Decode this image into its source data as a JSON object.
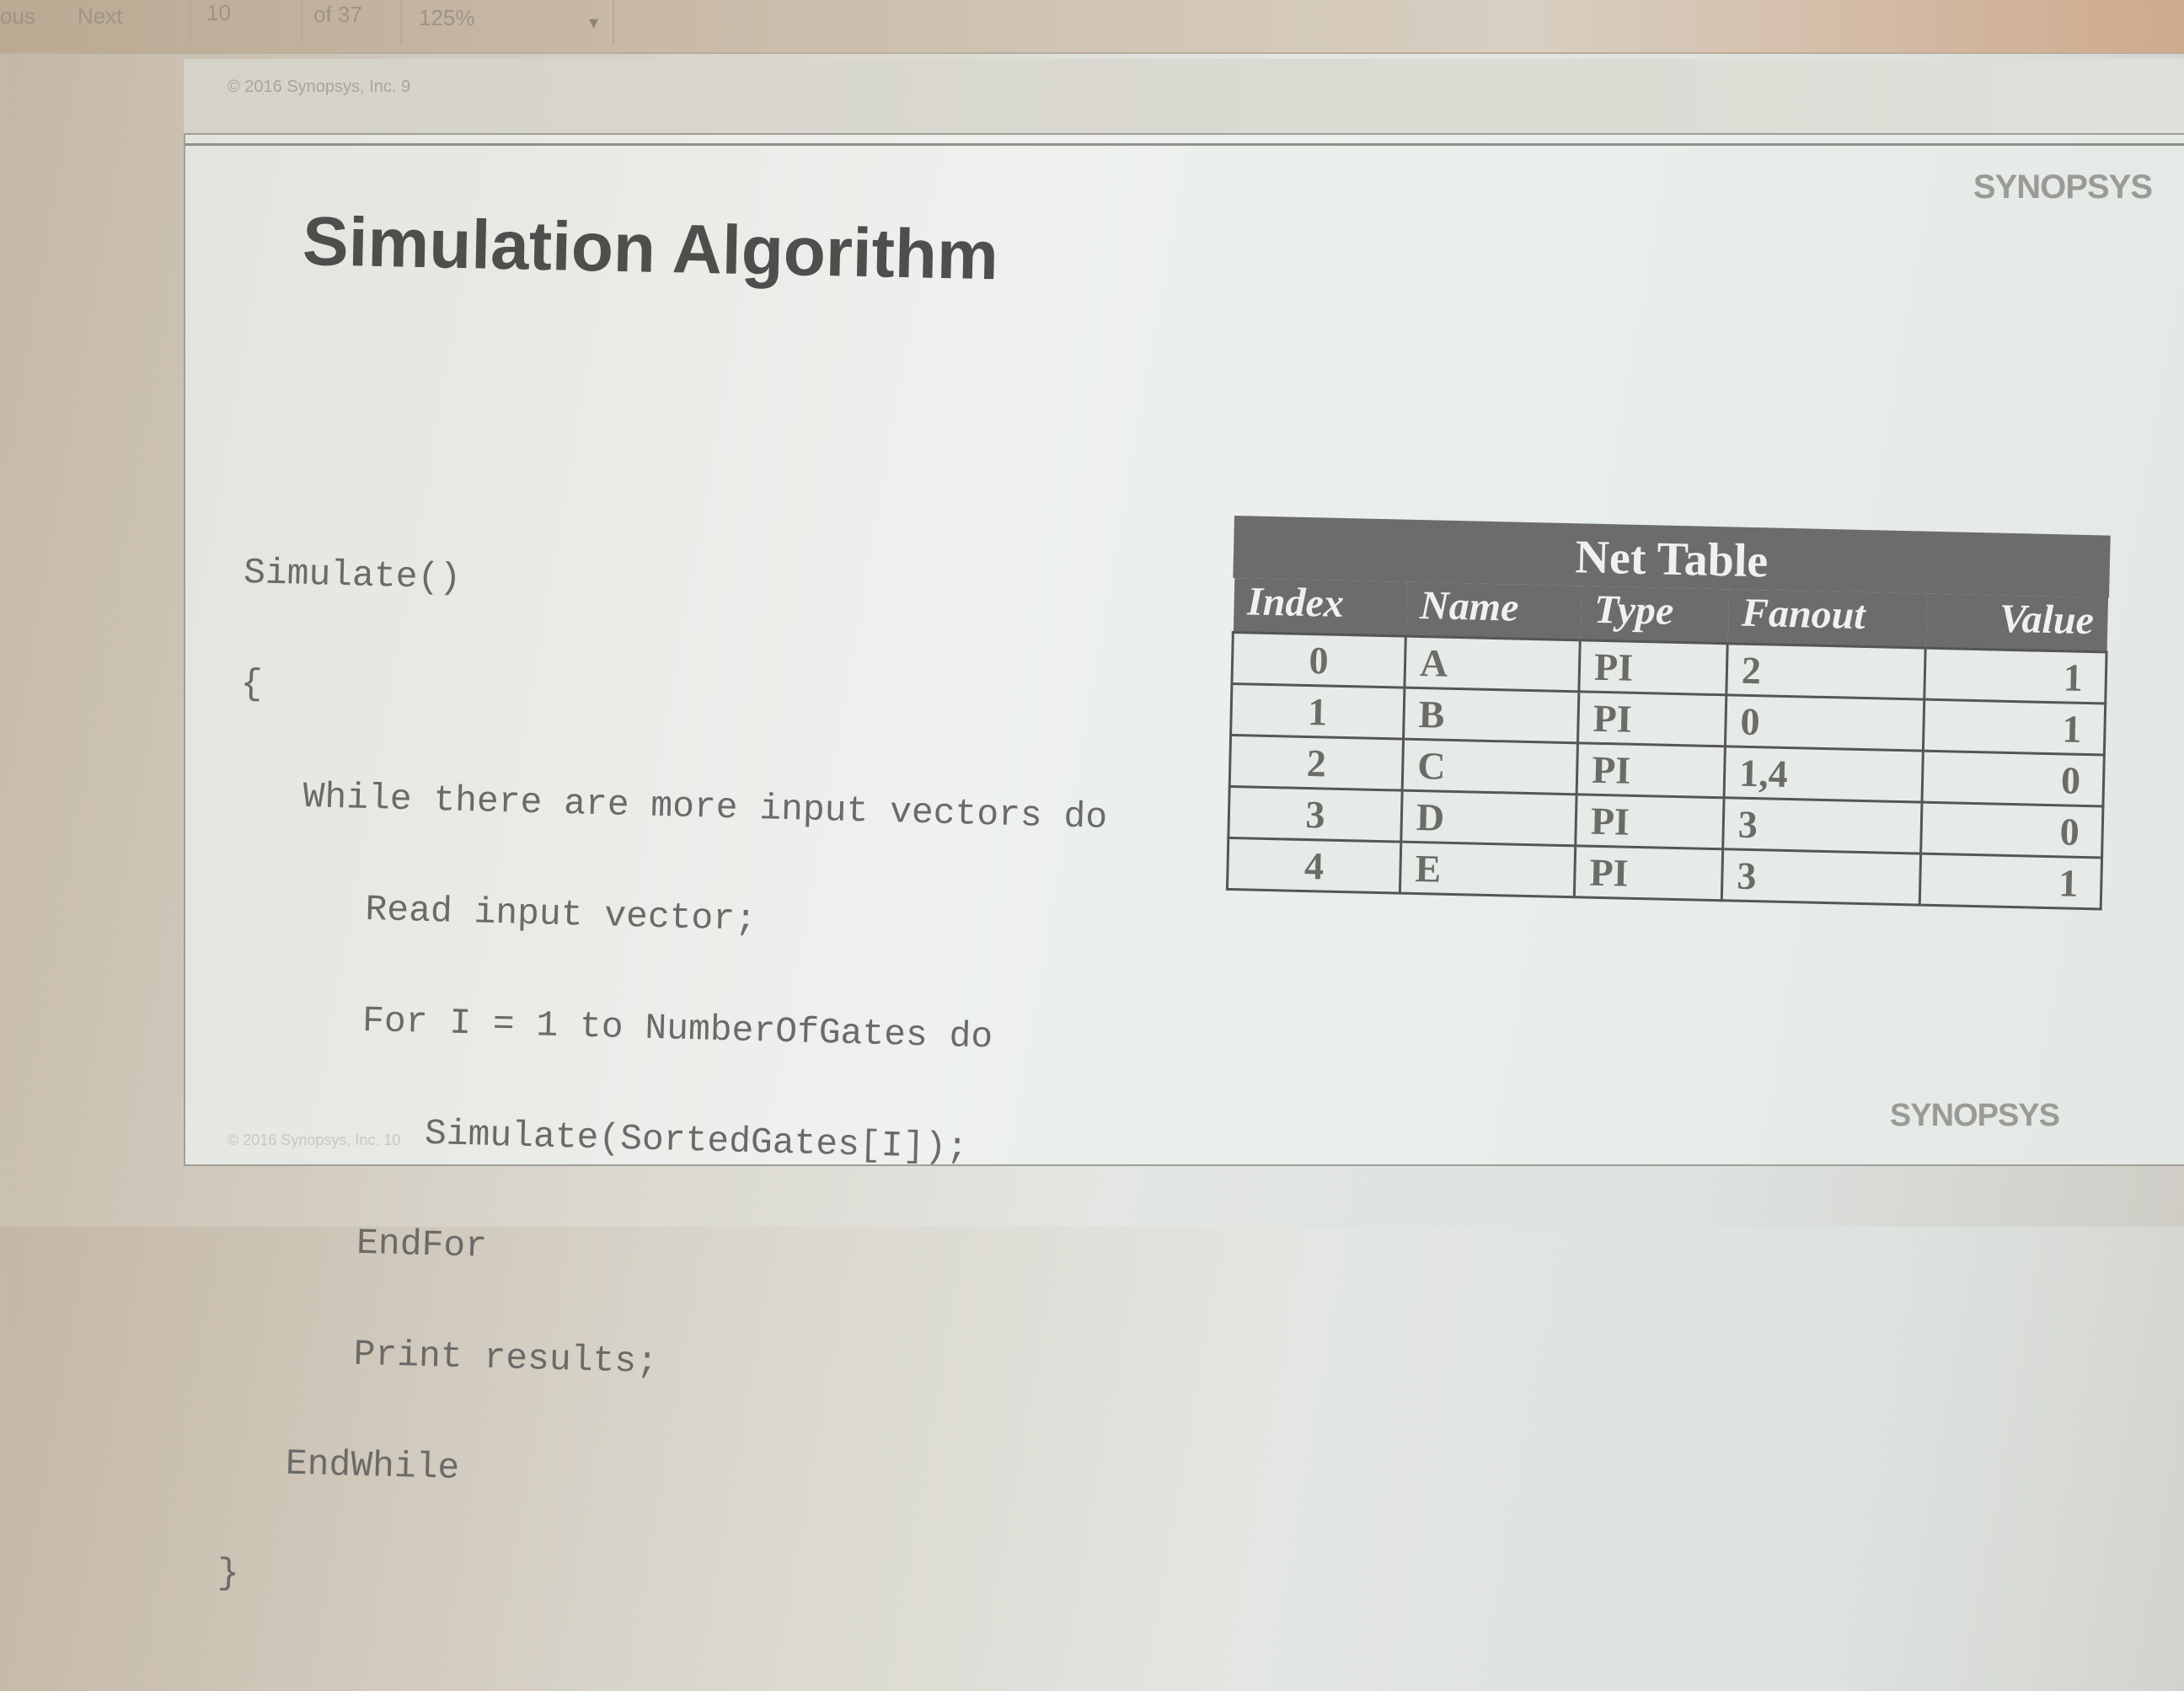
{
  "toolbar": {
    "prev_label": "ous",
    "next_label": "Next",
    "page_current": "10",
    "page_total": "of 37",
    "zoom": "125%"
  },
  "page_header": {
    "copyright": "© 2016 Synopsys, Inc.   9"
  },
  "slide": {
    "brand": "SYNOPSYS",
    "title": "Simulation Algorithm",
    "code_lines": [
      "Simulate()",
      "{",
      "   While there are more input vectors do",
      "      Read input vector;",
      "      For I = 1 to NumberOfGates do",
      "         Simulate(SortedGates[I]);",
      "      EndFor",
      "      Print results;",
      "   EndWhile",
      "}"
    ],
    "footer_copy": "© 2016 Synopsys, Inc.   10",
    "brand_bottom": "SYNOPSYS"
  },
  "net_table": {
    "caption": "Net Table",
    "headers": [
      "Index",
      "Name",
      "Type",
      "Fanout",
      "Value"
    ],
    "rows": [
      [
        "0",
        "A",
        "PI",
        "2",
        "1"
      ],
      [
        "1",
        "B",
        "PI",
        "0",
        "1"
      ],
      [
        "2",
        "C",
        "PI",
        "1,4",
        "0"
      ],
      [
        "3",
        "D",
        "PI",
        "3",
        "0"
      ],
      [
        "4",
        "E",
        "PI",
        "3",
        "1"
      ]
    ]
  }
}
